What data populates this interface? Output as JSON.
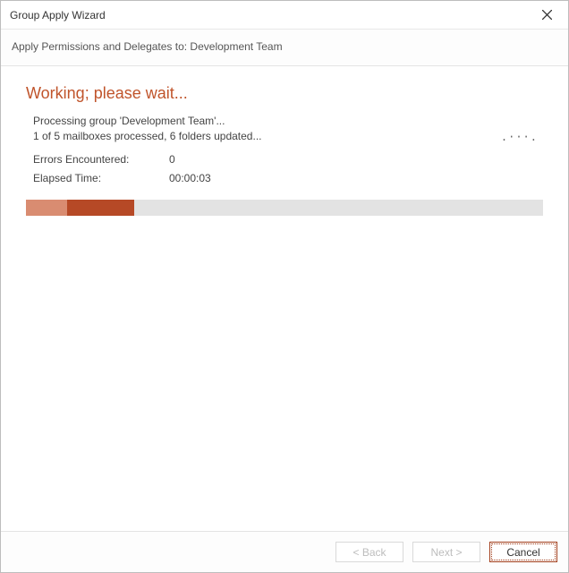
{
  "titlebar": {
    "title": "Group Apply Wizard"
  },
  "subtitle": "Apply Permissions and Delegates to: Development Team",
  "heading": "Working; please wait...",
  "status": {
    "line1": "Processing group 'Development Team'...",
    "line2": "1 of 5 mailboxes processed, 6 folders updated..."
  },
  "errors": {
    "label": "Errors Encountered:",
    "value": "0"
  },
  "elapsed": {
    "label": "Elapsed Time:",
    "value": "00:00:03"
  },
  "spinner_glyph": ".···.",
  "progress": {
    "percent_light": 8,
    "percent_dark_end": 21
  },
  "buttons": {
    "back": "< Back",
    "next": "Next >",
    "cancel": "Cancel"
  }
}
